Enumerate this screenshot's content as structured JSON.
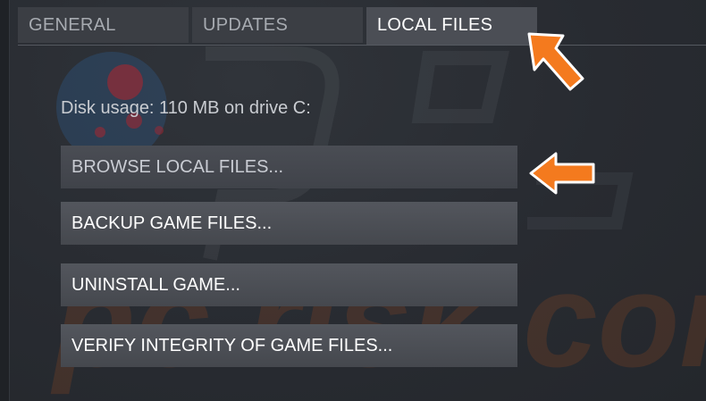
{
  "tabs": [
    {
      "label": "GENERAL"
    },
    {
      "label": "UPDATES"
    },
    {
      "label": "LOCAL FILES"
    }
  ],
  "disk_usage": "Disk usage: 110 MB on drive C:",
  "buttons": [
    {
      "label": "BROWSE LOCAL FILES..."
    },
    {
      "label": "BACKUP GAME FILES..."
    },
    {
      "label": "UNINSTALL GAME..."
    },
    {
      "label": "VERIFY INTEGRITY OF GAME FILES..."
    }
  ],
  "watermark": {
    "text": "pc risk.com"
  },
  "colors": {
    "background": "#282b31",
    "tab_inactive": "#3b3e44",
    "tab_active": "#4b4e55",
    "button": "#4e5158",
    "annotation_arrow": "#f47a1e"
  },
  "icons": {
    "annotation": "orange-arrow-icon"
  }
}
